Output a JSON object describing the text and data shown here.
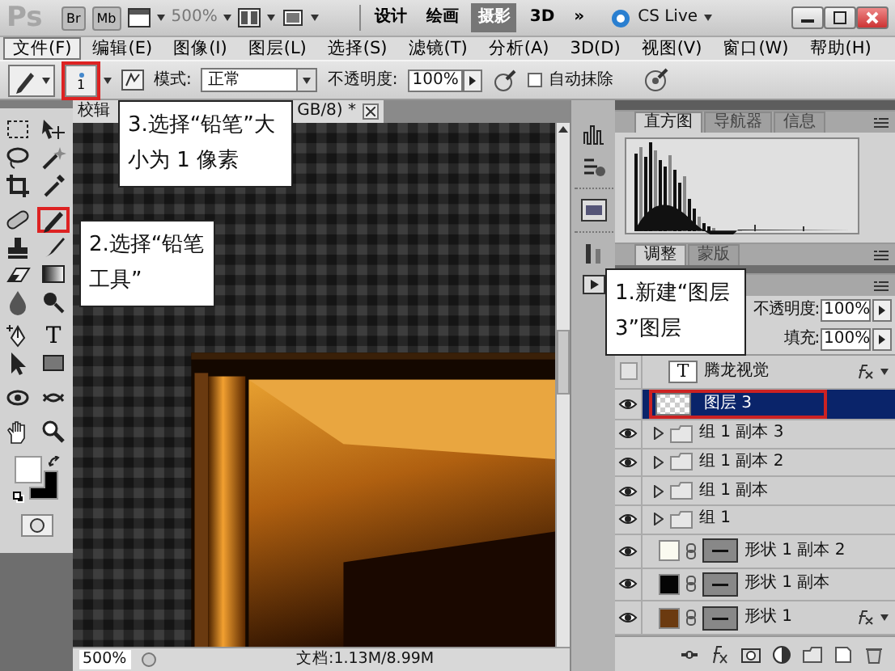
{
  "title_bar": {
    "logo": "Ps",
    "app_buttons": [
      "Br",
      "Mb"
    ],
    "zoom": "500%",
    "workspaces": [
      {
        "label": "设计",
        "selected": false
      },
      {
        "label": "绘画",
        "selected": false
      },
      {
        "label": "摄影",
        "selected": true
      },
      {
        "label": "3D",
        "selected": false
      },
      {
        "label": "»",
        "selected": false
      }
    ],
    "cs_live": "CS Live"
  },
  "menu": [
    {
      "label": "文件(F)",
      "selected": true
    },
    {
      "label": "编辑(E)",
      "selected": false
    },
    {
      "label": "图像(I)",
      "selected": false
    },
    {
      "label": "图层(L)",
      "selected": false
    },
    {
      "label": "选择(S)",
      "selected": false
    },
    {
      "label": "滤镜(T)",
      "selected": false
    },
    {
      "label": "分析(A)",
      "selected": false
    },
    {
      "label": "3D(D)",
      "selected": false
    },
    {
      "label": "视图(V)",
      "selected": false
    },
    {
      "label": "窗口(W)",
      "selected": false
    },
    {
      "label": "帮助(H)",
      "selected": false
    }
  ],
  "options_bar": {
    "brush_size": {
      "value": "1",
      "highlighted": true
    },
    "mode_label": "模式:",
    "mode": "正常",
    "opacity_label": "不透明度:",
    "opacity": "100%",
    "auto_erase": {
      "label": "自动抹除",
      "checked": false
    }
  },
  "document": {
    "tab_left": "校辑",
    "tab_right": "GB/8) *",
    "status_zoom": "500%",
    "status_info": "文档:1.13M/8.99M"
  },
  "tools": [
    {
      "kind": "marquee",
      "highlighted": false
    },
    {
      "kind": "move",
      "highlighted": false
    },
    {
      "kind": "lasso",
      "highlighted": false
    },
    {
      "kind": "wand",
      "highlighted": false
    },
    {
      "kind": "crop",
      "highlighted": false
    },
    {
      "kind": "eyedropper",
      "highlighted": false
    },
    {
      "kind": "healing",
      "highlighted": false
    },
    {
      "kind": "pencil",
      "highlighted": true
    },
    {
      "kind": "stamp",
      "highlighted": false
    },
    {
      "kind": "history",
      "highlighted": false
    },
    {
      "kind": "eraser",
      "highlighted": false
    },
    {
      "kind": "gradient",
      "highlighted": false
    },
    {
      "kind": "blur",
      "highlighted": false
    },
    {
      "kind": "dodge",
      "highlighted": false
    },
    {
      "kind": "pen",
      "highlighted": false
    },
    {
      "kind": "type",
      "glyph": "T",
      "highlighted": false
    },
    {
      "kind": "select",
      "highlighted": false
    },
    {
      "kind": "shape",
      "highlighted": false
    },
    {
      "kind": "rotate",
      "highlighted": false
    },
    {
      "kind": "orbit",
      "highlighted": false
    },
    {
      "kind": "hand",
      "highlighted": false
    },
    {
      "kind": "zoom",
      "highlighted": false
    }
  ],
  "swatches": [
    {
      "kind": "foreground",
      "color": "#ffffff"
    },
    {
      "kind": "background",
      "color": "#000000"
    }
  ],
  "callouts": [
    {
      "text": "3.选择“铅笔”大小为 1 像素"
    },
    {
      "text": "2.选择“铅笔工具”"
    },
    {
      "text": "1.新建“图层3”图层"
    }
  ],
  "histogram_panel": {
    "tabs": [
      {
        "label": "直方图",
        "selected": true
      },
      {
        "label": "导航器",
        "selected": false
      },
      {
        "label": "信息",
        "selected": false
      }
    ]
  },
  "adjust_panel": {
    "tabs": [
      {
        "label": "调整",
        "selected": true
      },
      {
        "label": "蒙版",
        "selected": false
      }
    ]
  },
  "layers_panel": {
    "opacity_label": "不透明度:",
    "opacity": "100%",
    "fill_label": "填充:",
    "fill": "100%",
    "layers": [
      {
        "kind": "text",
        "name": "腾龙视觉",
        "glyph": "T",
        "visible": false,
        "selected": false,
        "highlighted": false,
        "fx": true
      },
      {
        "kind": "pixel",
        "name": "图层 3",
        "visible": true,
        "selected": true,
        "highlighted": true,
        "fx": false
      },
      {
        "kind": "group",
        "name": "组 1 副本 3",
        "visible": true,
        "selected": false,
        "highlighted": false,
        "fx": false
      },
      {
        "kind": "group",
        "name": "组 1 副本 2",
        "visible": true,
        "selected": false,
        "highlighted": false,
        "fx": false
      },
      {
        "kind": "group",
        "name": "组 1 副本",
        "visible": true,
        "selected": false,
        "highlighted": false,
        "fx": false
      },
      {
        "kind": "group",
        "name": "组 1",
        "visible": true,
        "selected": false,
        "highlighted": false,
        "fx": false
      },
      {
        "kind": "shape",
        "name": "形状 1 副本 2",
        "color": "#fafaf0",
        "visible": true,
        "selected": false,
        "highlighted": false,
        "fx": false
      },
      {
        "kind": "shape",
        "name": "形状 1 副本",
        "color": "#050505",
        "visible": true,
        "selected": false,
        "highlighted": false,
        "fx": false
      },
      {
        "kind": "shape",
        "name": "形状 1",
        "color": "#6b3a10",
        "visible": true,
        "selected": false,
        "highlighted": false,
        "fx": true
      }
    ]
  }
}
